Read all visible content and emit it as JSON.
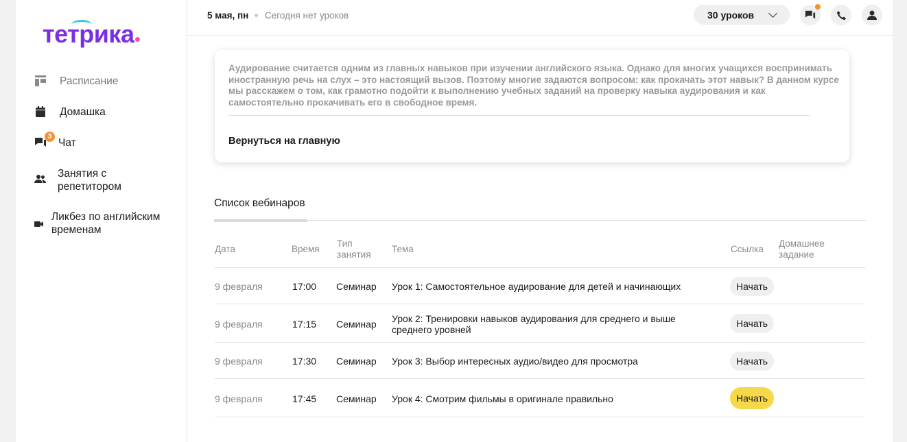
{
  "brand": {
    "logo_text": "тетрика"
  },
  "sidebar": {
    "items": [
      {
        "label": "Расписание",
        "icon": "schedule-icon"
      },
      {
        "label": "Домашка",
        "icon": "calendar-icon"
      },
      {
        "label": "Чат",
        "icon": "chat-icon",
        "badge": "3"
      },
      {
        "label": "Занятия с репетитором",
        "icon": "people-icon"
      },
      {
        "label": "Ликбез по английским временам",
        "icon": "video-icon"
      }
    ]
  },
  "header": {
    "date": "5 мая, пн",
    "status": "Сегодня нет уроков",
    "lessons_button": "30 уроков"
  },
  "card": {
    "description": "Аудирование считается одним из главных навыков при изучении английского языка. Однако для многих учащихся воспринимать иностранную речь на слух – это настоящий вызов. Поэтому многие задаются вопросом: как прокачать этот навык? В данном курсе мы расскажем о том, как грамотно подойти к выполнению учебных заданий на проверку навыка аудирования и как самостоятельно прокачивать его в свободное время.",
    "back_link": "Вернуться на главную"
  },
  "tabs": {
    "webinars": "Список вебинаров"
  },
  "table": {
    "headers": {
      "date": "Дата",
      "time": "Время",
      "type": "Тип занятия",
      "topic": "Тема",
      "link": "Ссылка",
      "homework": "Домашнее задание"
    },
    "rows": [
      {
        "date": "9 февраля",
        "time": "17:00",
        "type": "Семинар",
        "topic": "Урок 1: Самостоятельное аудирование для детей и начинающих",
        "action": "Начать"
      },
      {
        "date": "9 февраля",
        "time": "17:15",
        "type": "Семинар",
        "topic": "Урок 2: Тренировки навыков аудирования для среднего и выше среднего уровней",
        "action": "Начать"
      },
      {
        "date": "9 февраля",
        "time": "17:30",
        "type": "Семинар",
        "topic": "Урок 3: Выбор интересных аудио/видео для просмотра",
        "action": "Начать"
      },
      {
        "date": "9 февраля",
        "time": "17:45",
        "type": "Семинар",
        "topic": "Урок 4: Смотрим фильмы в оригинале правильно",
        "action": "Начать"
      }
    ]
  },
  "colors": {
    "brand_purple": "#7a2ee6",
    "brand_cyan": "#2dc7e6",
    "brand_pink": "#ff4fa3",
    "badge_orange": "#f5922e",
    "accent_yellow": "#f6d94a"
  }
}
